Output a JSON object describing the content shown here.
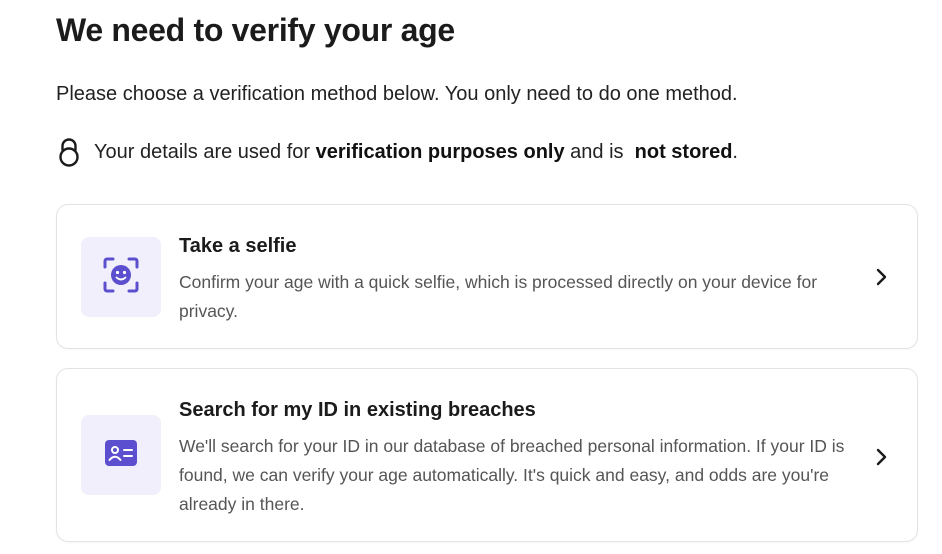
{
  "header": {
    "title": "We need to verify your age",
    "intro": "Please choose a verification method below. You only need to do one method."
  },
  "privacy_note": {
    "icon": "lock-icon",
    "prefix": "Your details are used for ",
    "bold_1": "verification purposes only",
    "middle": " and is ",
    "bold_2": "not stored",
    "suffix": "."
  },
  "methods": [
    {
      "icon": "face-scan-icon",
      "title": "Take a selfie",
      "description": "Confirm your age with a quick selfie, which is processed directly on your device for privacy."
    },
    {
      "icon": "id-card-icon",
      "title": "Search for my ID in existing breaches",
      "description": "We'll search for your ID in our database of breached personal information. If your ID is found, we can verify your age automatically. It's quick and easy, and odds are you're already in there."
    }
  ],
  "colors": {
    "accent": "#6a5bd6",
    "icon_tile_bg": "#f1effb",
    "card_border": "#e3e3e6"
  }
}
